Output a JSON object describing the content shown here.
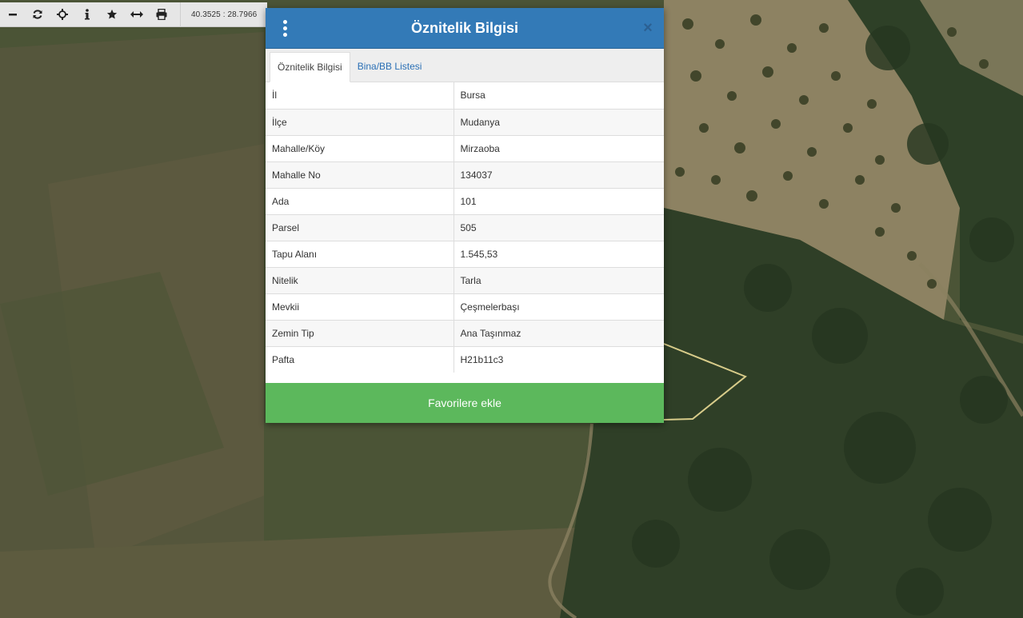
{
  "toolbar": {
    "coords": "40.3525 : 28.7966",
    "icons": [
      "minus-icon",
      "refresh-icon",
      "crosshair-icon",
      "info-icon",
      "star-icon",
      "measure-icon",
      "print-icon"
    ]
  },
  "dialog": {
    "title": "Öznitelik Bilgisi",
    "close_label": "×",
    "tabs": [
      {
        "label": "Öznitelik Bilgisi",
        "active": true
      },
      {
        "label": "Bina/BB Listesi",
        "active": false
      }
    ],
    "rows": [
      {
        "key": "İl",
        "value": "Bursa"
      },
      {
        "key": "İlçe",
        "value": "Mudanya"
      },
      {
        "key": "Mahalle/Köy",
        "value": "Mirzaoba"
      },
      {
        "key": "Mahalle No",
        "value": "134037"
      },
      {
        "key": "Ada",
        "value": "101"
      },
      {
        "key": "Parsel",
        "value": "505"
      },
      {
        "key": "Tapu Alanı",
        "value": "1.545,53"
      },
      {
        "key": "Nitelik",
        "value": "Tarla"
      },
      {
        "key": "Mevkii",
        "value": "Çeşmelerbaşı"
      },
      {
        "key": "Zemin Tip",
        "value": "Ana Taşınmaz"
      },
      {
        "key": "Pafta",
        "value": "H21b11c3"
      }
    ],
    "favorite_button": "Favorilere ekle"
  },
  "colors": {
    "header": "#337ab7",
    "favorite": "#5cb85c",
    "parcel_outline": "#d8cc8a"
  }
}
